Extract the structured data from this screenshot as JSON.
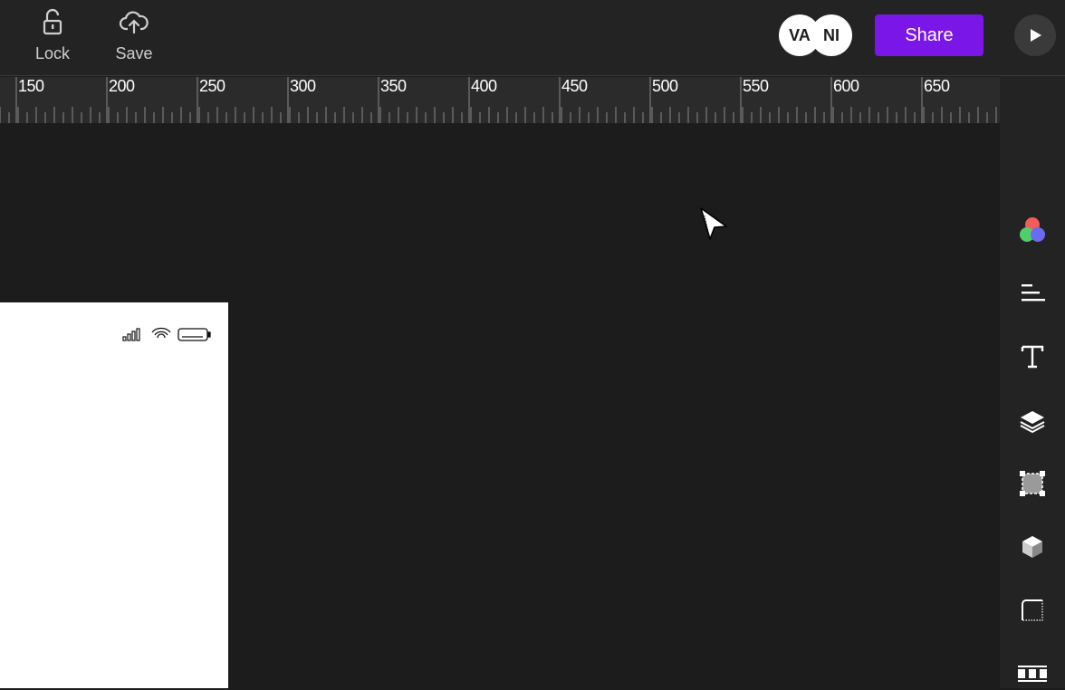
{
  "toolbar": {
    "lock_label": "Lock",
    "save_label": "Save",
    "share_label": "Share",
    "collaborators": [
      "VA",
      "NI"
    ]
  },
  "ruler": {
    "labels": [
      "150",
      "200",
      "250",
      "300",
      "350",
      "400",
      "450",
      "500",
      "550",
      "600",
      "650"
    ]
  },
  "right_panel": {
    "icons": [
      "color-palette-icon",
      "align-left-icon",
      "text-icon",
      "layers-icon",
      "selection-frame-icon",
      "3d-object-icon",
      "corner-radius-icon",
      "grid-layout-icon"
    ]
  },
  "colors": {
    "accent": "#7b16e8",
    "background": "#1c1c1c",
    "panel": "#232323"
  }
}
